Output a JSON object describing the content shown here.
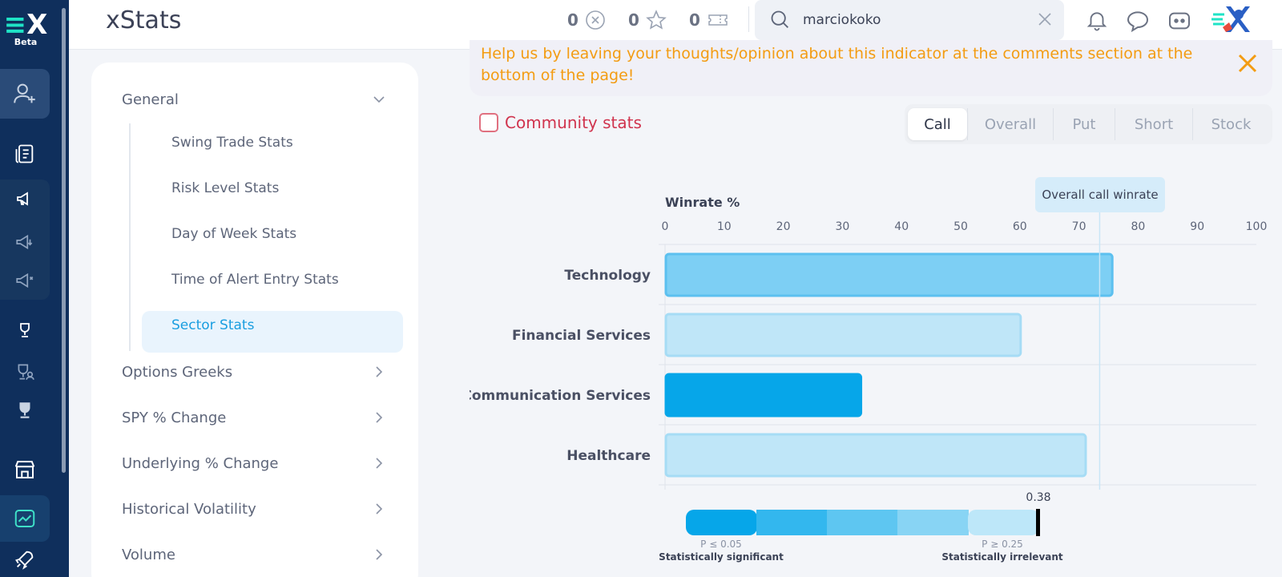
{
  "app": {
    "title": "xStats",
    "logo_text": "X",
    "badge": "Beta"
  },
  "topbar": {
    "counters": [
      {
        "value": "0",
        "icon": "x-coin-icon"
      },
      {
        "value": "0",
        "icon": "star-icon"
      },
      {
        "value": "0",
        "icon": "ticket-icon"
      }
    ],
    "search": {
      "value": "marciokoko",
      "placeholder": "Search"
    },
    "icons": [
      "bell-icon",
      "chat-icon",
      "discord-icon",
      "avatar"
    ]
  },
  "rail": {
    "icons": [
      "add-user-icon",
      "document-icon",
      "megaphone-icon",
      "megaphone-down-icon",
      "megaphone-alt-icon",
      "trophy-icon",
      "trophy-user-icon",
      "trophy-filled-icon",
      "store-icon",
      "chart-line-icon",
      "rocket-icon"
    ]
  },
  "sidebar": {
    "general": {
      "label": "General"
    },
    "sub_items": [
      {
        "label": "Swing Trade Stats"
      },
      {
        "label": "Risk Level Stats"
      },
      {
        "label": "Day of Week Stats"
      },
      {
        "label": "Time of Alert Entry Stats"
      },
      {
        "label": "Sector Stats"
      }
    ],
    "items": [
      {
        "label": "Options Greeks"
      },
      {
        "label": "SPY % Change"
      },
      {
        "label": "Underlying % Change"
      },
      {
        "label": "Historical Volatility"
      },
      {
        "label": "Volume"
      }
    ]
  },
  "notice": {
    "text": "Help us by leaving your thoughts/opinion about this indicator at the comments section at the bottom of the page!"
  },
  "community": {
    "label": "Community stats",
    "checked": false
  },
  "tabs": [
    {
      "label": "Call",
      "active": true
    },
    {
      "label": "Overall",
      "active": false
    },
    {
      "label": "Put",
      "active": false
    },
    {
      "label": "Short",
      "active": false
    },
    {
      "label": "Stock",
      "active": false
    }
  ],
  "overall_label": "Overall call winrate",
  "chart_data": {
    "type": "bar",
    "orientation": "horizontal",
    "title": "Winrate %",
    "categories": [
      "Technology",
      "Financial Services",
      "Communication Services",
      "Healthcare"
    ],
    "values": [
      75.5,
      60,
      33,
      71
    ],
    "xlim": [
      0,
      100
    ],
    "xticks": [
      0,
      10,
      20,
      30,
      40,
      50,
      60,
      70,
      80,
      90,
      100
    ],
    "reference_line": 73.5,
    "bar_colors": [
      "#7dcff4",
      "#bfe6f8",
      "#06a6e9",
      "#bfe6f8"
    ],
    "bar_borders": [
      "#5cc0ef",
      "#a6dcf5",
      "#06a6e9",
      "#a6dcf5"
    ],
    "significance": {
      "value": "0.38",
      "left_label": "P ≤ 0.05",
      "left_caption": "Statistically significant",
      "right_label": "P ≥ 0.25",
      "right_caption": "Statistically irrelevant",
      "segment_colors": [
        "#06a6e9",
        "#33b7ee",
        "#5ec6f1",
        "#88d4f4",
        "#bde7f9"
      ]
    }
  }
}
